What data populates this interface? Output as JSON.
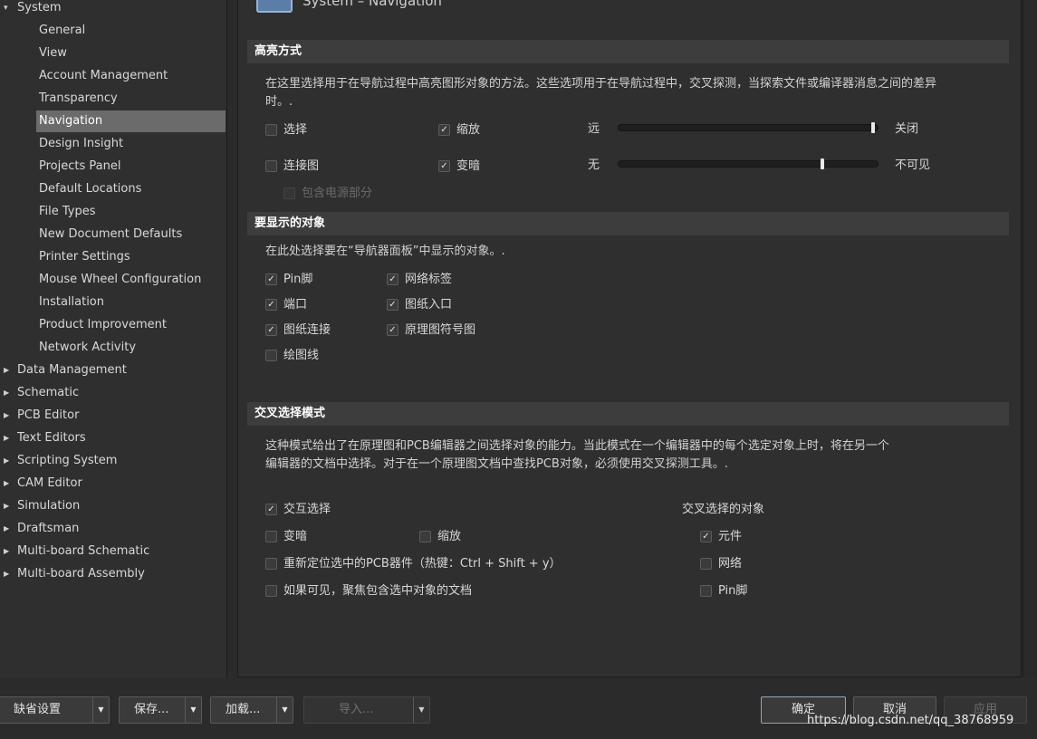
{
  "tree": {
    "top_items": [
      {
        "label": "System",
        "expanded": true
      },
      {
        "label": "Data Management"
      },
      {
        "label": "Schematic"
      },
      {
        "label": "PCB Editor"
      },
      {
        "label": "Text Editors"
      },
      {
        "label": "Scripting System"
      },
      {
        "label": "CAM Editor"
      },
      {
        "label": "Simulation"
      },
      {
        "label": "Draftsman"
      },
      {
        "label": "Multi-board Schematic"
      },
      {
        "label": "Multi-board Assembly"
      }
    ],
    "system_children": [
      "General",
      "View",
      "Account Management",
      "Transparency",
      "Navigation",
      "Design Insight",
      "Projects Panel",
      "Default Locations",
      "File Types",
      "New Document Defaults",
      "Printer Settings",
      "Mouse Wheel Configuration",
      "Installation",
      "Product Improvement",
      "Network Activity"
    ],
    "selected": "Navigation"
  },
  "header": {
    "title": "System – Navigation"
  },
  "highlight": {
    "title": "高亮方式",
    "description_line1": "在这里选择用于在导航过程中高亮图形对象的方法。这些选项用于在导航过程中，交叉探测，当探索文件或编译器消息之间的差异",
    "description_line2": "时。.",
    "select_label": "选择",
    "zoom_label": "缩放",
    "connection_label": "连接图",
    "dim_label": "变暗",
    "power_label": "包含电源部分",
    "slider1_left": "远",
    "slider1_right": "关闭",
    "slider1_value": 0.99,
    "slider2_left": "无",
    "slider2_right": "不可见",
    "slider2_value": 0.79
  },
  "objects": {
    "title": "要显示的对象",
    "description": "在此处选择要在“导航器面板”中显示的对象。.",
    "pin": "Pin脚",
    "net_label": "网络标签",
    "port": "端口",
    "sheet_entry": "图纸入口",
    "sheet_conn": "图纸连接",
    "sheet_symbol": "原理图符号图",
    "drawing_line": "绘图线"
  },
  "cross": {
    "title": "交叉选择模式",
    "description_line1": "这种模式给出了在原理图和PCB编辑器之间选择对象的能力。当此模式在一个编辑器中的每个选定对象上时，将在另一个",
    "description_line2": "编辑器的文档中选择。对于在一个原理图文档中查找PCB对象，必须使用交叉探测工具。.",
    "interactive": "交互选择",
    "dim": "变暗",
    "zoom": "缩放",
    "relocate": "重新定位选中的PCB器件（热键：Ctrl + Shift + y）",
    "focus": "如果可见，聚焦包含选中对象的文档",
    "objects_title": "交叉选择的对象",
    "component": "元件",
    "net": "网络",
    "pin": "Pin脚"
  },
  "buttons": {
    "defaults": "缺省设置",
    "save": "保存...",
    "load": "加载...",
    "import": "导入...",
    "ok": "确定",
    "cancel": "取消",
    "apply": "应用"
  },
  "watermark": "https://blog.csdn.net/qq_38768959",
  "check_mark": "✓"
}
